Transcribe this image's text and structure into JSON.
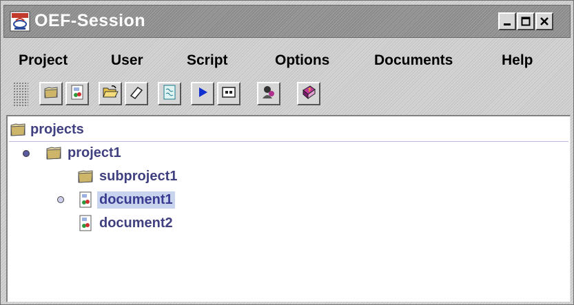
{
  "window": {
    "title": "OEF-Session"
  },
  "menubar": {
    "items": [
      "Project",
      "User",
      "Script",
      "Options",
      "Documents",
      "Help"
    ]
  },
  "toolbar": {
    "buttons": [
      {
        "icon": "folder-icon"
      },
      {
        "icon": "document-icon"
      },
      {
        "icon": "open-folder-icon"
      },
      {
        "icon": "eraser-icon"
      },
      {
        "icon": "script-document-icon"
      },
      {
        "icon": "play-icon"
      },
      {
        "icon": "console-icon"
      },
      {
        "icon": "user-icon"
      },
      {
        "icon": "help-book-icon"
      }
    ]
  },
  "tree": {
    "root": "projects",
    "nodes": [
      {
        "label": "project1",
        "type": "folder",
        "expanded": true
      },
      {
        "label": "subproject1",
        "type": "folder"
      },
      {
        "label": "document1",
        "type": "document",
        "selected": true
      },
      {
        "label": "document2",
        "type": "document"
      }
    ]
  },
  "colors": {
    "tree_text": "#404080",
    "selection": "#c8d4ee",
    "title_bar": "#8e8e8e"
  }
}
